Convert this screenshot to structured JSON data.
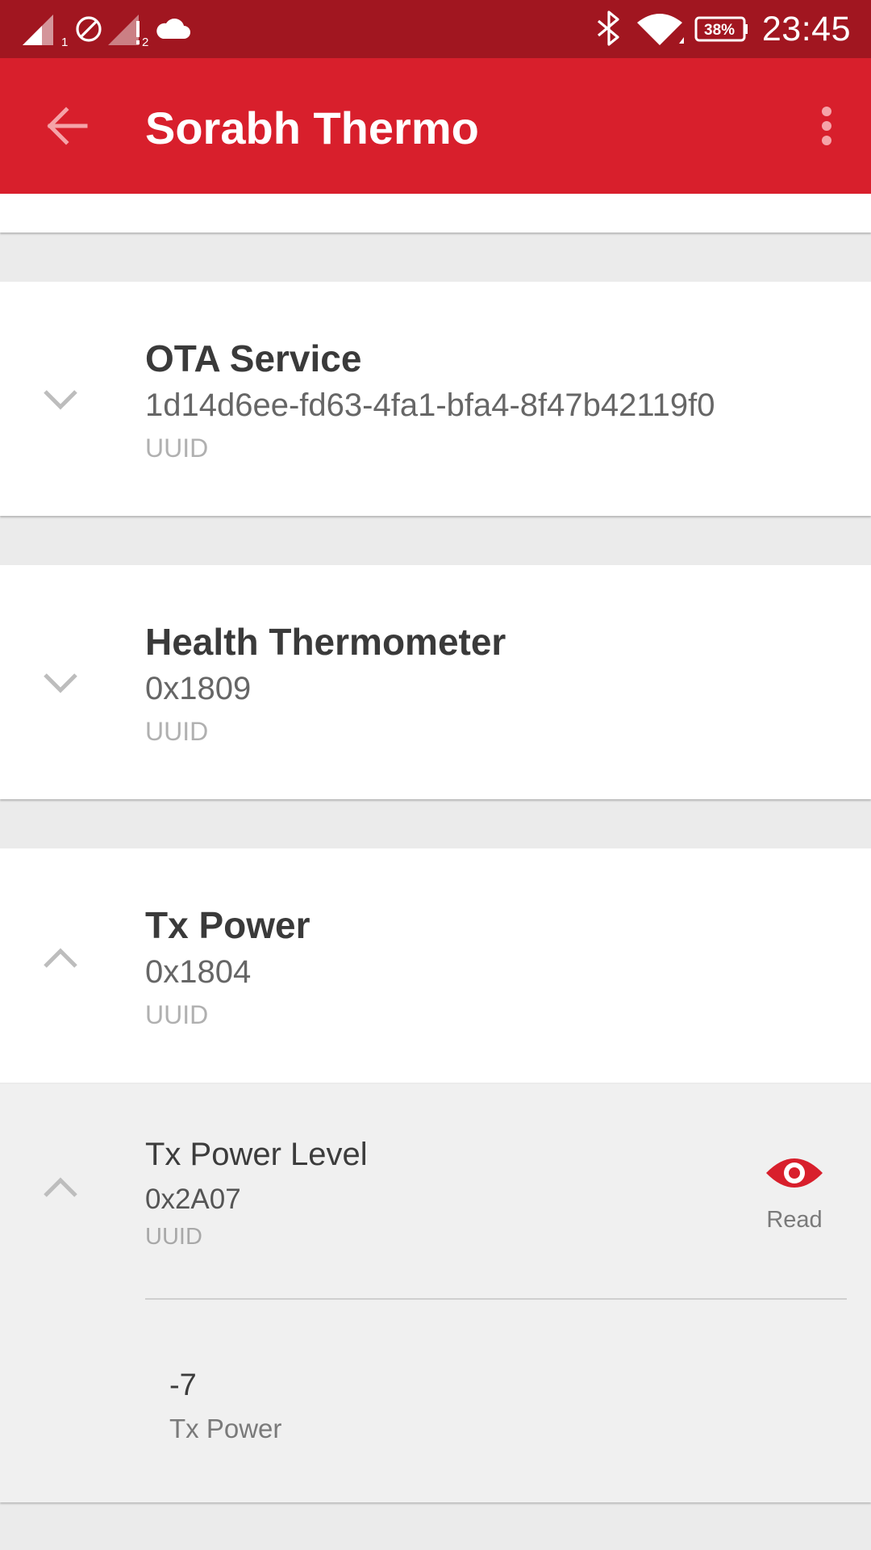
{
  "status_bar": {
    "time": "23:45",
    "battery_percent": "38%",
    "icons": [
      "signal-sim1-icon",
      "do-not-disturb-icon",
      "signal-sim2-icon",
      "cloud-icon",
      "bluetooth-icon",
      "wifi-icon",
      "battery-icon"
    ],
    "sim1_label": "1",
    "sim2_label": "2"
  },
  "app_bar": {
    "title": "Sorabh Thermo",
    "back_icon": "arrow-back-icon",
    "menu_icon": "more-vert-icon",
    "color": "#d81f2c",
    "status_color": "#a11620"
  },
  "services": [
    {
      "name": "OTA Service",
      "uuid": "1d14d6ee-fd63-4fa1-bfa4-8f47b42119f0",
      "uuid_caption": "UUID",
      "expanded": false
    },
    {
      "name": "Health Thermometer",
      "uuid": "0x1809",
      "uuid_caption": "UUID",
      "expanded": false
    },
    {
      "name": "Tx Power",
      "uuid": "0x1804",
      "uuid_caption": "UUID",
      "expanded": true
    }
  ],
  "characteristic": {
    "name": "Tx Power Level",
    "uuid": "0x2A07",
    "uuid_caption": "UUID",
    "expanded": true,
    "action_label": "Read",
    "action_icon": "eye-icon",
    "value": "-7",
    "value_caption": "Tx Power"
  }
}
